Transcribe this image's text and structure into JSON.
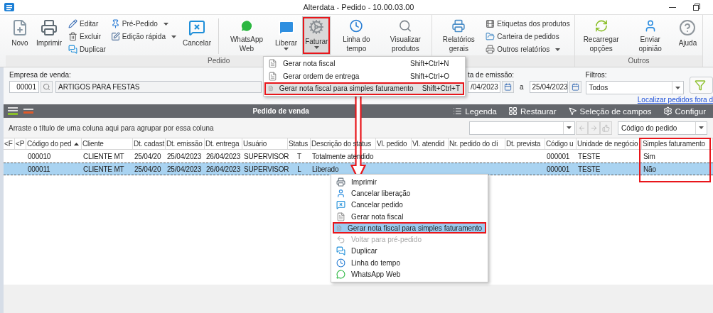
{
  "window": {
    "title": "Alterdata - Pedido - 10.00.03.00"
  },
  "ribbon": {
    "groups": [
      {
        "label": "Pedido",
        "items": [
          {
            "kind": "large",
            "label": "Novo"
          },
          {
            "kind": "large",
            "label": "Imprimir"
          },
          {
            "kind": "stack",
            "items": [
              {
                "label": "Editar"
              },
              {
                "label": "Excluir"
              },
              {
                "label": "Duplicar"
              }
            ]
          },
          {
            "kind": "stack",
            "items": [
              {
                "label": "Pré-Pedido",
                "dropdown": true
              },
              {
                "label": "Edição rápida",
                "dropdown": true
              }
            ]
          },
          {
            "kind": "large",
            "label": "Cancelar"
          },
          {
            "kind": "separator"
          },
          {
            "kind": "large",
            "label": "WhatsApp Web"
          },
          {
            "kind": "large",
            "label": "Liberar",
            "dropdown": true
          },
          {
            "kind": "large",
            "label": "Faturar",
            "dropdown": true,
            "pressed": true,
            "highlighted": true
          },
          {
            "kind": "large",
            "label": "Linha do tempo"
          },
          {
            "kind": "large",
            "label": "Visualizar produtos"
          }
        ]
      },
      {
        "items": [
          {
            "kind": "large",
            "label": "Relatórios gerais"
          },
          {
            "kind": "stack",
            "items": [
              {
                "label": "Etiquetas dos produtos"
              },
              {
                "label": "Carteira de pedidos"
              },
              {
                "label": "Outros relatórios",
                "dropdown": true
              }
            ]
          }
        ]
      },
      {
        "label": "Outros",
        "items": [
          {
            "kind": "large",
            "label": "Recarregar opções"
          },
          {
            "kind": "large",
            "label": "Enviar opinião"
          },
          {
            "kind": "large",
            "label": "Ajuda"
          }
        ]
      }
    ]
  },
  "dropdown_menu": {
    "items": [
      {
        "label": "Gerar nota fiscal",
        "shortcut": "Shift+Ctrl+N",
        "selected": false,
        "highlighted": false
      },
      {
        "label": "Gerar ordem de entrega",
        "shortcut": "Shift+Ctrl+O",
        "selected": false,
        "highlighted": false
      },
      {
        "label": "Gerar nota fiscal para simples faturamento",
        "shortcut": "Shift+Ctrl+T",
        "selected": true,
        "highlighted": true
      }
    ]
  },
  "filters": {
    "company": {
      "label": "Empresa de venda:",
      "code": "00001",
      "name": "ARTIGOS PARA FESTAS"
    },
    "date": {
      "label": "ta de emissão:",
      "from": "/04/2023",
      "separator": "a",
      "to": "25/04/2023"
    },
    "filter": {
      "label": "Filtros:",
      "value": "Todos"
    },
    "link": "Localizar pedidos fora d"
  },
  "grid": {
    "title": "Pedido de venda",
    "actions": [
      "Legenda",
      "Restaurar",
      "Seleção de campos",
      "Configur"
    ],
    "group_hint": "Arraste o título de uma coluna aqui para agrupar por essa coluna",
    "sort_field": "Código do pedido",
    "columns": [
      {
        "label": "<F",
        "sorted": false,
        "highlighted": false
      },
      {
        "label": "<P",
        "sorted": false,
        "highlighted": false
      },
      {
        "label": "Código do ped",
        "sorted": true,
        "highlighted": false
      },
      {
        "label": "Cliente",
        "sorted": false,
        "highlighted": false
      },
      {
        "label": "Dt. cadast",
        "sorted": false,
        "highlighted": false
      },
      {
        "label": "Dt. emissão",
        "sorted": false,
        "highlighted": false
      },
      {
        "label": "Dt. entrega",
        "sorted": false,
        "highlighted": false
      },
      {
        "label": "Usuário",
        "sorted": false,
        "highlighted": false
      },
      {
        "label": "Status",
        "sorted": false,
        "highlighted": false
      },
      {
        "label": "Descrição do status",
        "sorted": false,
        "highlighted": false
      },
      {
        "label": "Vl. pedido",
        "sorted": false,
        "highlighted": false
      },
      {
        "label": "Vl. atendid",
        "sorted": false,
        "highlighted": false
      },
      {
        "label": "Nr. pedido do cli",
        "sorted": false,
        "highlighted": false
      },
      {
        "label": "Dt. prevista",
        "sorted": false,
        "highlighted": false
      },
      {
        "label": "Código u",
        "sorted": false,
        "highlighted": false
      },
      {
        "label": "Unidade de negócio",
        "sorted": false,
        "highlighted": false
      },
      {
        "label": "Simples faturamento",
        "sorted": false,
        "highlighted": true
      }
    ],
    "rows": [
      {
        "selected": false,
        "cells": [
          null,
          null,
          "000010",
          "CLIENTE MT",
          "25/04/20",
          "25/04/2023",
          "26/04/2023",
          "SUPERVISOR",
          "T",
          "Totalmente atendido",
          null,
          null,
          null,
          null,
          "000001",
          "TESTE",
          "Sim"
        ]
      },
      {
        "selected": true,
        "cells": [
          null,
          null,
          "000011",
          "CLIENTE MT",
          "25/04/20",
          "25/04/2023",
          "26/04/2023",
          "SUPERVISOR",
          "L",
          "Liberado",
          null,
          null,
          null,
          null,
          "000001",
          "TESTE",
          "Não"
        ]
      }
    ]
  },
  "context_menu": {
    "items": [
      {
        "label": "Imprimir",
        "selected": false,
        "disabled": false,
        "highlighted": false
      },
      {
        "label": "Cancelar liberação",
        "selected": false,
        "disabled": false,
        "highlighted": false
      },
      {
        "label": "Cancelar pedido",
        "selected": false,
        "disabled": false,
        "highlighted": false
      },
      {
        "label": "Gerar nota fiscal",
        "selected": false,
        "disabled": false,
        "highlighted": false
      },
      {
        "label": "Gerar nota fiscal para simples faturamento",
        "selected": true,
        "disabled": false,
        "highlighted": true
      },
      {
        "label": "Voltar para pré-pedido",
        "selected": false,
        "disabled": true,
        "highlighted": false
      },
      {
        "label": "Duplicar",
        "selected": false,
        "disabled": false,
        "highlighted": false
      },
      {
        "label": "Linha do tempo",
        "selected": false,
        "disabled": false,
        "highlighted": false
      },
      {
        "label": "WhatsApp Web",
        "selected": false,
        "disabled": false,
        "highlighted": false
      }
    ]
  },
  "callout_arrow": true
}
